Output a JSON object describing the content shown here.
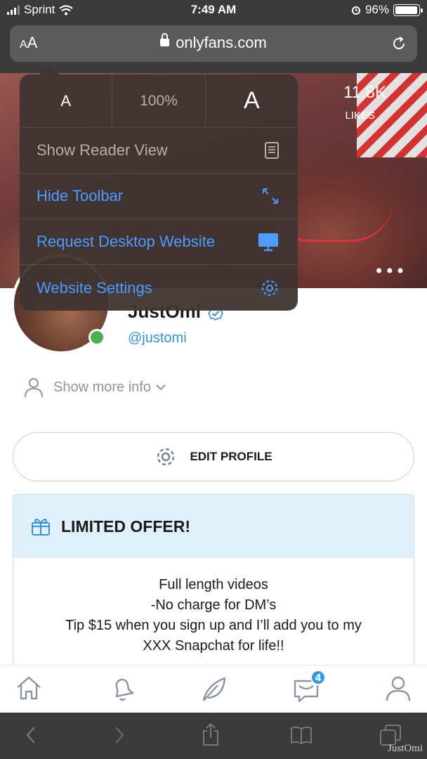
{
  "status_bar": {
    "carrier": "Sprint",
    "time": "7:49 AM",
    "battery": "96%"
  },
  "url_bar": {
    "text_size_label_small": "A",
    "text_size_label_big": "A",
    "domain": "onlyfans.com"
  },
  "banner": {
    "likes_count": "11.8K",
    "likes_label": "LIKES",
    "more": "•••"
  },
  "profile": {
    "name": "JustOmi",
    "handle": "@justomi",
    "show_more": "Show more info"
  },
  "edit_profile": "EDIT PROFILE",
  "offer": {
    "title": "LIMITED OFFER!",
    "lines": [
      "Full length videos",
      "-No charge for DM’s",
      "Tip $15 when you sign up and I’ll add you to my",
      "XXX Snapchat for life!!"
    ]
  },
  "nav": {
    "messages_badge": "4"
  },
  "popover": {
    "zoom_smaller": "A",
    "zoom_level": "100%",
    "zoom_larger": "A",
    "items": [
      {
        "label": "Show Reader View",
        "icon": "reader-icon"
      },
      {
        "label": "Hide Toolbar",
        "icon": "expand-arrows-icon"
      },
      {
        "label": "Request Desktop Website",
        "icon": "desktop-icon"
      },
      {
        "label": "Website Settings",
        "icon": "gear-icon"
      }
    ]
  },
  "watermark": "JustOmi",
  "colors": {
    "accent": "#3a8fd6",
    "menu_blue": "#4f9bff",
    "online": "#4caf50",
    "offer_bg": "#e0f1fb"
  }
}
